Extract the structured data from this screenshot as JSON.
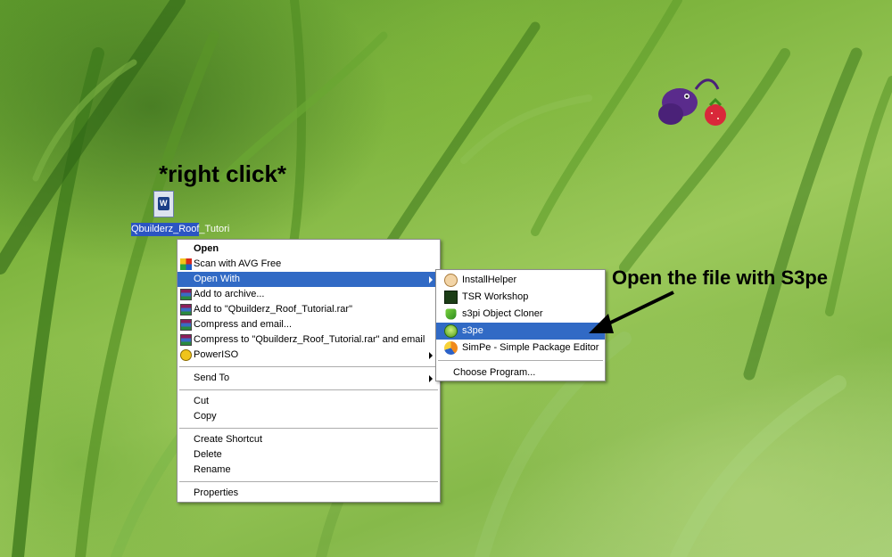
{
  "desktop_icon": {
    "label": "Qbuilderz_Roof_Tutori",
    "glyph": "W"
  },
  "annotations": {
    "right_click": "*right click*",
    "open_with_s3pe": "Open the file with S3pe"
  },
  "context_menu": {
    "items": [
      {
        "label": "Open",
        "bold": true,
        "icon": ""
      },
      {
        "label": "Scan with AVG Free",
        "icon": "avg-icon"
      },
      {
        "label": "Open With",
        "icon": "",
        "submenu": true,
        "highlighted": true
      },
      {
        "label": "Add to archive...",
        "icon": "winrar-icon"
      },
      {
        "label": "Add to \"Qbuilderz_Roof_Tutorial.rar\"",
        "icon": "winrar-icon"
      },
      {
        "label": "Compress and email...",
        "icon": "winrar-icon"
      },
      {
        "label": "Compress to \"Qbuilderz_Roof_Tutorial.rar\" and email",
        "icon": "winrar-icon"
      },
      {
        "label": "PowerISO",
        "icon": "poweriso-icon",
        "submenu": true
      },
      {
        "label": "Send To",
        "submenu": true
      },
      {
        "label": "Cut"
      },
      {
        "label": "Copy"
      },
      {
        "label": "Create Shortcut"
      },
      {
        "label": "Delete"
      },
      {
        "label": "Rename"
      },
      {
        "label": "Properties"
      }
    ]
  },
  "open_with_submenu": {
    "items": [
      {
        "label": "InstallHelper",
        "icon": "installhelper-icon"
      },
      {
        "label": "TSR Workshop",
        "icon": "tsr-workshop-icon"
      },
      {
        "label": "s3pi Object Cloner",
        "icon": "s3pi-icon"
      },
      {
        "label": "s3pe",
        "icon": "s3pe-icon",
        "highlighted": true
      },
      {
        "label": "SimPe - Simple Package Editor",
        "icon": "simpe-icon"
      },
      {
        "label": "Choose Program..."
      }
    ]
  },
  "colors": {
    "highlight": "#316ac5",
    "selection_label": "#2b55c2"
  }
}
